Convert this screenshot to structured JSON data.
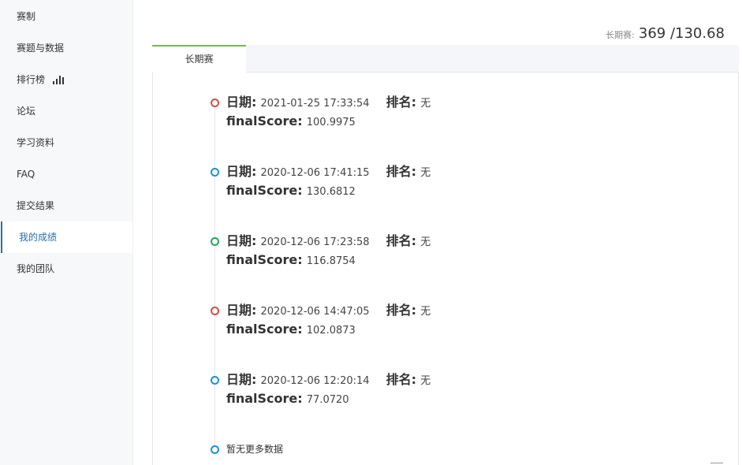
{
  "sidebar": {
    "items": [
      {
        "label": "赛制"
      },
      {
        "label": "赛题与数据"
      },
      {
        "label": "排行榜"
      },
      {
        "label": "论坛"
      },
      {
        "label": "学习资料"
      },
      {
        "label": "FAQ"
      },
      {
        "label": "提交结果"
      },
      {
        "label": "我的成绩"
      },
      {
        "label": "我的团队"
      }
    ],
    "active": "我的成绩"
  },
  "score_header": {
    "label": "长期赛:",
    "value": "369 /130.68"
  },
  "tabs": [
    {
      "label": "长期赛"
    }
  ],
  "timeline": {
    "date_label": "日期:",
    "rank_label": "排名:",
    "score_label": "finalScore:",
    "entries": [
      {
        "date": "2021-01-25 17:33:54",
        "rank": "无",
        "score": "100.9975",
        "dot_color": "#e04a3f"
      },
      {
        "date": "2020-12-06 17:41:15",
        "rank": "无",
        "score": "130.6812",
        "dot_color": "#1e90d6"
      },
      {
        "date": "2020-12-06 17:23:58",
        "rank": "无",
        "score": "116.8754",
        "dot_color": "#26a65b"
      },
      {
        "date": "2020-12-06 14:47:05",
        "rank": "无",
        "score": "102.0873",
        "dot_color": "#e04a3f"
      },
      {
        "date": "2020-12-06 12:20:14",
        "rank": "无",
        "score": "77.0720",
        "dot_color": "#1e90d6"
      }
    ],
    "no_more": "暂无更多数据"
  }
}
